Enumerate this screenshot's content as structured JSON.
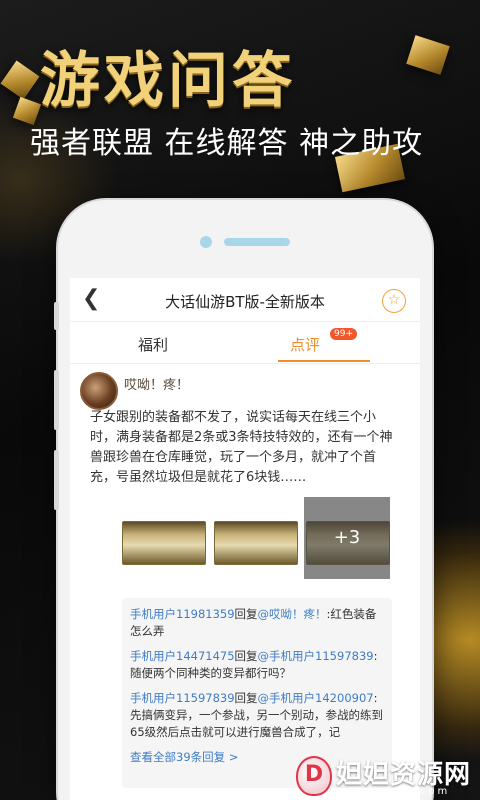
{
  "poster": {
    "title": "游戏问答",
    "subtitle": "强者联盟 在线解答 神之助攻"
  },
  "app": {
    "nav": {
      "back_icon": "chevron-left-icon",
      "title": "大话仙游BT版-全新版本",
      "favorite_icon": "star-icon"
    },
    "tabs": [
      {
        "label": "福利",
        "active": false
      },
      {
        "label": "点评",
        "active": true,
        "badge": "99+"
      }
    ],
    "post": {
      "username": "哎呦！疼！",
      "text": "子女跟别的装备都不发了，说实话每天在线三个小时，满身装备都是2条或3条特技特效的，还有一个神兽跟珍兽在仓库睡觉，玩了一个多月，就冲了个首充，号虽然垃圾但是就花了6块钱……",
      "more_images": "+3"
    },
    "replies": [
      {
        "from": "手机用户11981359",
        "verb": "回复",
        "to": "@哎呦！疼！",
        "text": ":红色装备怎么弄"
      },
      {
        "from": "手机用户14471475",
        "verb": "回复",
        "to": "@手机用户11597839",
        "text": ":随便两个同种类的变异都行吗？"
      },
      {
        "from": "手机用户11597839",
        "verb": "回复",
        "to": "@手机用户14200907",
        "text": ":先搞俩变异，一个参战，另一个别动，参战的练到65级然后点击就可以进行魔兽合成了，记"
      }
    ],
    "view_all": "查看全部39条回复 >"
  },
  "watermark": {
    "logo_letter": "D",
    "text": "妲妲资源网",
    "domain": "dadazzz.com"
  },
  "colors": {
    "accent": "#ee8e2c",
    "link": "#3f7cc4",
    "badge": "#f2562b",
    "gold": "#f1d27a"
  }
}
